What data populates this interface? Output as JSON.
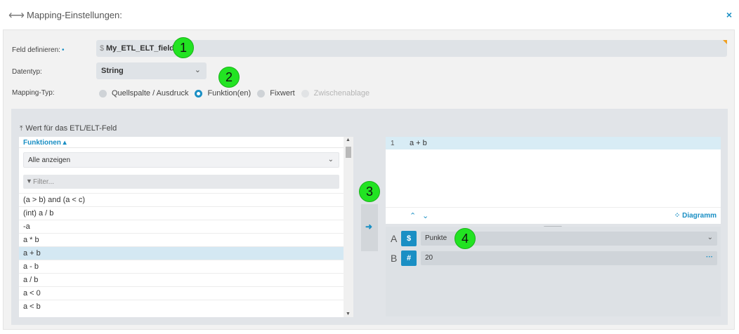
{
  "header": {
    "arrows_icon": "double-arrow-icon",
    "title": "Mapping-Einstellungen:",
    "close_icon": "×"
  },
  "form": {
    "field_label": "Feld definieren:",
    "field_required_mark": "•",
    "field_prefix": "$",
    "field_value": "My_ETL_ELT_field",
    "datatype_label": "Datentyp:",
    "datatype_value": "String",
    "mapping_label": "Mapping-Typ:",
    "mapping_options": [
      {
        "label": "Quellspalte / Ausdruck",
        "selected": false,
        "disabled": false
      },
      {
        "label": "Funktion(en)",
        "selected": true,
        "disabled": false
      },
      {
        "label": "Fixwert",
        "selected": false,
        "disabled": false
      },
      {
        "label": "Zwischenablage",
        "selected": false,
        "disabled": true
      }
    ]
  },
  "badges": [
    "1",
    "2",
    "3",
    "4"
  ],
  "work": {
    "title": "Wert für das ETL/ELT-Feld",
    "functions_header": "Funktionen",
    "show_all": "Alle anzeigen",
    "filter_placeholder": "Filter...",
    "functions": [
      "(a > b) and (a < c)",
      "(int) a / b",
      "-a",
      "a * b",
      "a + b",
      "a - b",
      "a / b",
      "a < 0",
      "a < b"
    ],
    "selected_function_index": 4,
    "editor_line_number": "1",
    "editor_code": "a + b",
    "diagram_label": "Diagramm",
    "params": [
      {
        "letter": "A",
        "type_symbol": "$",
        "value": "Punkte"
      },
      {
        "letter": "B",
        "type_symbol": "#",
        "value": "20"
      }
    ]
  },
  "colors": {
    "accent": "#1a8fc4",
    "badge": "#22e322"
  }
}
